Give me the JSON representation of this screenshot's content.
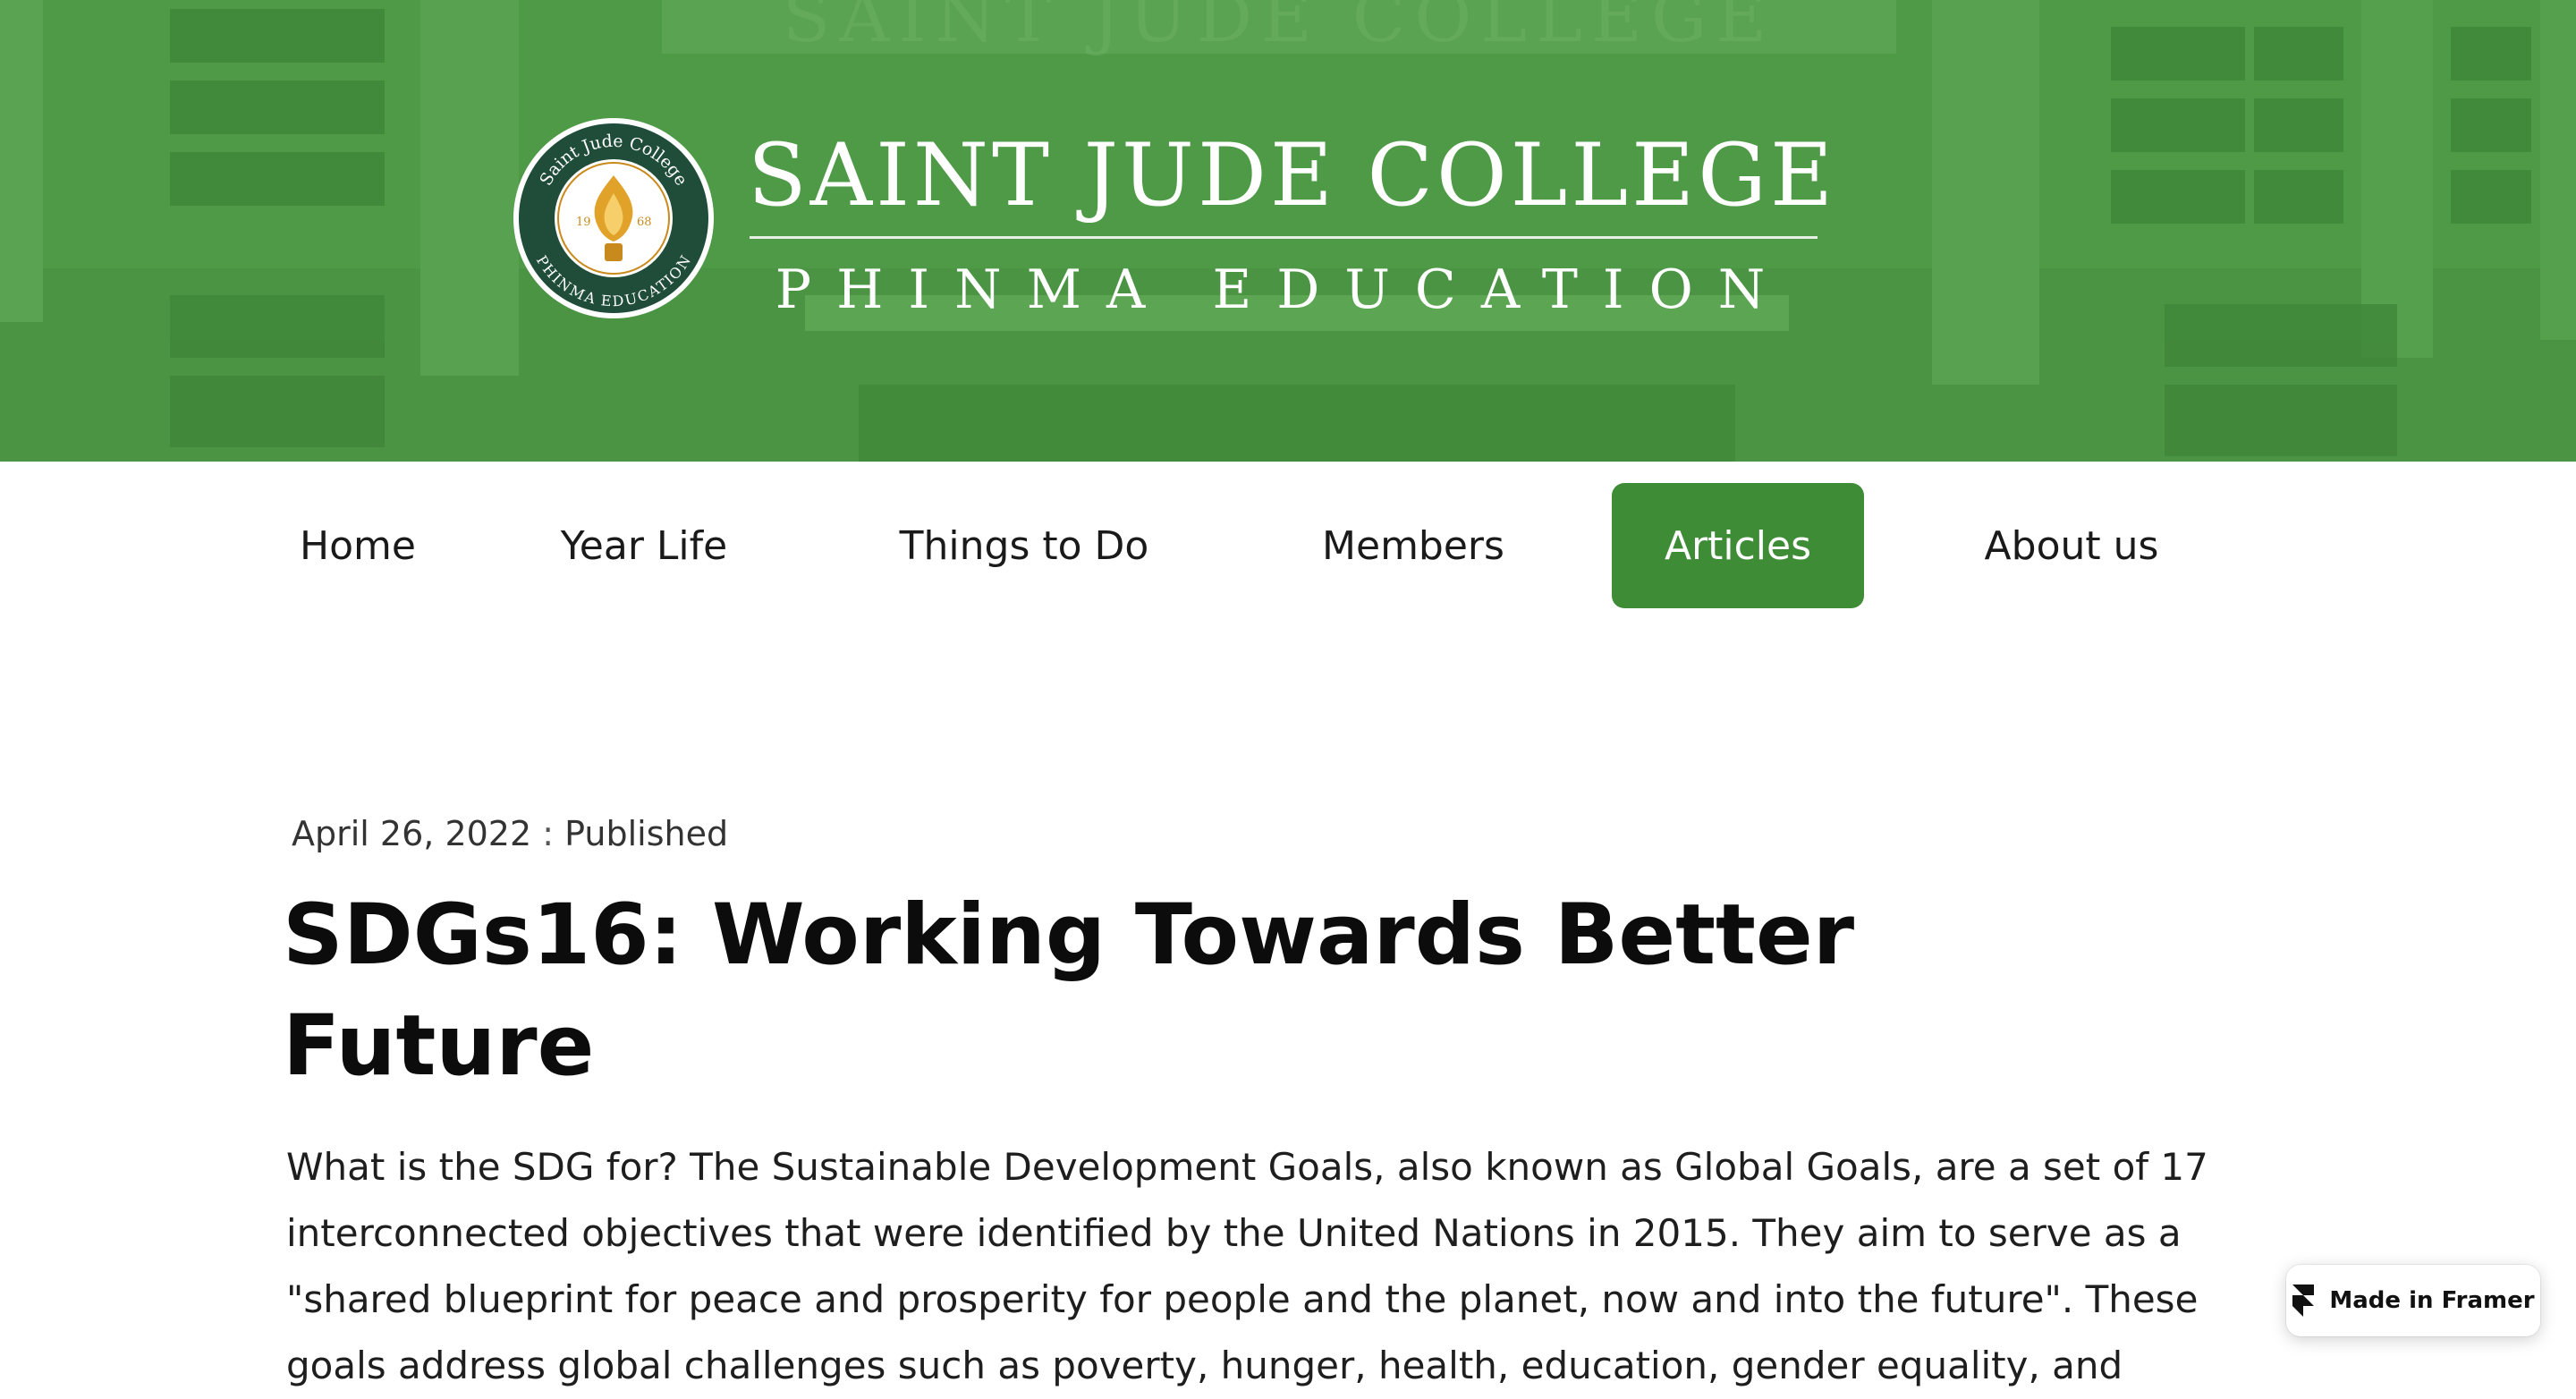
{
  "banner": {
    "brand_title": "SAINT JUDE COLLEGE",
    "brand_subtitle": "PHINMA EDUCATION",
    "seal_text_top": "Saint Jude College",
    "seal_text_bottom": "PHINMA EDUCATION",
    "seal_year_left": "19",
    "seal_year_right": "68",
    "background_color": "#4e9a47"
  },
  "nav": {
    "items": [
      {
        "label": "Home",
        "active": false
      },
      {
        "label": "Year Life",
        "active": false
      },
      {
        "label": "Things to Do",
        "active": false
      },
      {
        "label": "Members",
        "active": false
      },
      {
        "label": "Articles",
        "active": true
      },
      {
        "label": "About us",
        "active": false
      }
    ],
    "active_color": "#3f8c37"
  },
  "article": {
    "date": "April 26, 2022",
    "separator": ":",
    "status": "Published",
    "title_lines": [
      "SDGs16: Working Towards Better",
      "Future"
    ],
    "body_lines": [
      "What is the SDG for? The Sustainable Development Goals, also known as Global Goals, are a set of 17",
      "interconnected objectives that were identified by the United Nations in 2015. They aim to serve as a",
      "\"shared blueprint for peace and prosperity for people and the planet, now and into the future\". These",
      "goals address global challenges such as poverty, hunger, health, education, gender equality, and"
    ]
  },
  "badge": {
    "label": "Made in Framer",
    "icon": "framer-logo-icon"
  }
}
